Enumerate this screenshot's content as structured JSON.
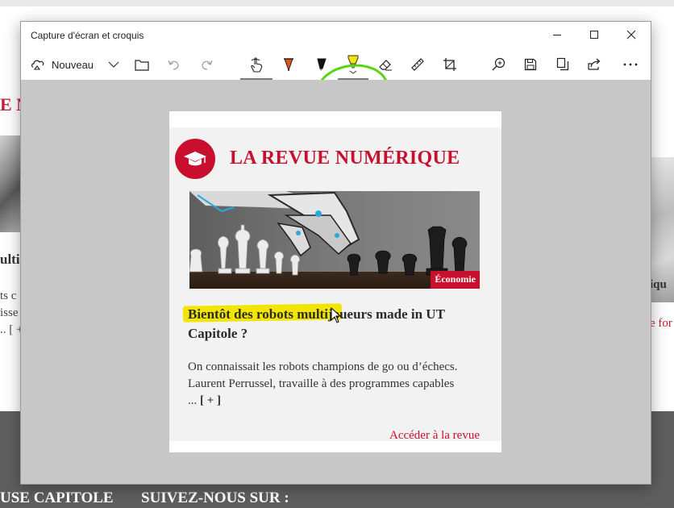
{
  "window": {
    "title": "Capture d'écran et croquis"
  },
  "toolbar": {
    "new_label": "Nouveau",
    "tools": [
      "touch-writing-icon",
      "ballpoint-pen-icon",
      "pencil-icon",
      "highlighter-icon",
      "eraser-icon",
      "ruler-icon",
      "crop-icon",
      "zoom-icon",
      "save-icon",
      "copy-icon",
      "share-icon",
      "more-icon"
    ],
    "highlighter_color": "#f2e600",
    "pen_color": "#e0531b"
  },
  "background_page": {
    "left_heading": "E N",
    "left_title": "ulti",
    "left_text": "ts c\nisse\n.. [ +",
    "right_label": "iqu",
    "right_link": "e for",
    "footer_left": "USE CAPITOLE",
    "footer_right": "SUIVEZ-NOUS SUR :"
  },
  "card": {
    "heading": "LA REVUE NUMÉRIQUE",
    "tag": "Économie",
    "article_title": "Bientôt des robots multijoueurs made in UT Capitole ?",
    "article_text": "On connaissait les robots champions de go ou d’échecs. Laurent Perrussel, travaille à des programmes capables ... ",
    "more": "[ + ]",
    "link": "Accéder à la revue",
    "accent": "#c8102e"
  }
}
